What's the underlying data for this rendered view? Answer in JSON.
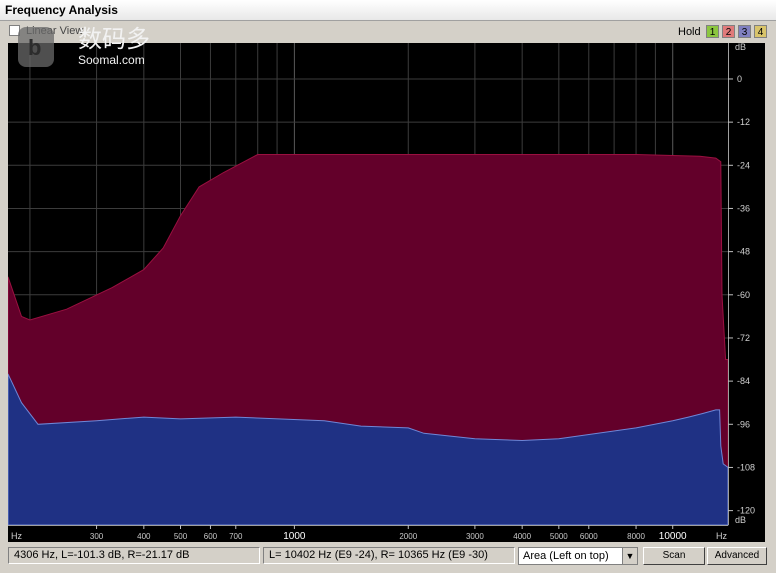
{
  "window": {
    "title": "Frequency Analysis"
  },
  "toolbar": {
    "linear_view_label": "Linear View",
    "linear_view_checked": false,
    "hold_label": "Hold",
    "hold_buttons": [
      {
        "label": "1",
        "color": "#8cc63f"
      },
      {
        "label": "2",
        "color": "#e07a7a"
      },
      {
        "label": "3",
        "color": "#8080c0"
      },
      {
        "label": "4",
        "color": "#d9c46a"
      }
    ]
  },
  "watermark": {
    "text": "数码多",
    "site": "Soomal.com"
  },
  "chart_data": {
    "type": "area",
    "xscale": "log",
    "x_unit_label": "Hz",
    "x_tick_labels": [
      "300",
      "400",
      "500",
      "600",
      "700",
      "1000",
      "2000",
      "3000",
      "4000",
      "5000",
      "6000",
      "8000",
      "10000"
    ],
    "y_unit_label": "dB",
    "y_tick_labels": [
      "0",
      "-12",
      "-24",
      "-36",
      "-48",
      "-60",
      "-72",
      "-84",
      "-96",
      "-108",
      "-120"
    ],
    "ylim": [
      -124,
      10
    ],
    "colors": {
      "background": "#000000",
      "grid": "#3c3c3c",
      "series_top": "#63002a",
      "series_bottom": "#1f3184"
    },
    "series": [
      {
        "color": "#63002a",
        "points": [
          [
            175,
            -55
          ],
          [
            190,
            -66
          ],
          [
            200,
            -67
          ],
          [
            250,
            -64
          ],
          [
            330,
            -58
          ],
          [
            400,
            -53
          ],
          [
            450,
            -47
          ],
          [
            500,
            -38
          ],
          [
            560,
            -30
          ],
          [
            650,
            -26
          ],
          [
            800,
            -21
          ],
          [
            2000,
            -21
          ],
          [
            8000,
            -21
          ],
          [
            11800,
            -21.5
          ],
          [
            13000,
            -22
          ],
          [
            13400,
            -23
          ],
          [
            13500,
            -60
          ],
          [
            13800,
            -78
          ],
          [
            14000,
            -78
          ]
        ]
      },
      {
        "color": "#1f3184",
        "points": [
          [
            175,
            -82
          ],
          [
            190,
            -90
          ],
          [
            210,
            -96
          ],
          [
            300,
            -95
          ],
          [
            400,
            -94
          ],
          [
            500,
            -94.5
          ],
          [
            700,
            -94
          ],
          [
            1200,
            -95
          ],
          [
            1500,
            -96.5
          ],
          [
            2000,
            -97
          ],
          [
            2200,
            -98.5
          ],
          [
            3000,
            -100
          ],
          [
            4000,
            -100.5
          ],
          [
            5000,
            -100
          ],
          [
            8000,
            -97
          ],
          [
            10000,
            -95
          ],
          [
            11000,
            -94
          ],
          [
            12000,
            -93
          ],
          [
            13000,
            -92
          ],
          [
            13300,
            -92
          ],
          [
            13400,
            -102
          ],
          [
            13600,
            -107
          ],
          [
            14000,
            -108
          ]
        ]
      }
    ]
  },
  "status": {
    "cursor_readout": "4306 Hz, L=-101.3 dB, R=-21.17 dB",
    "peak_readout": "L=  10402 Hz (E9 -24), R=  10365 Hz (E9 -30)",
    "graph_mode": "Area (Left on top)",
    "scan_label": "Scan",
    "advanced_label": "Advanced"
  }
}
